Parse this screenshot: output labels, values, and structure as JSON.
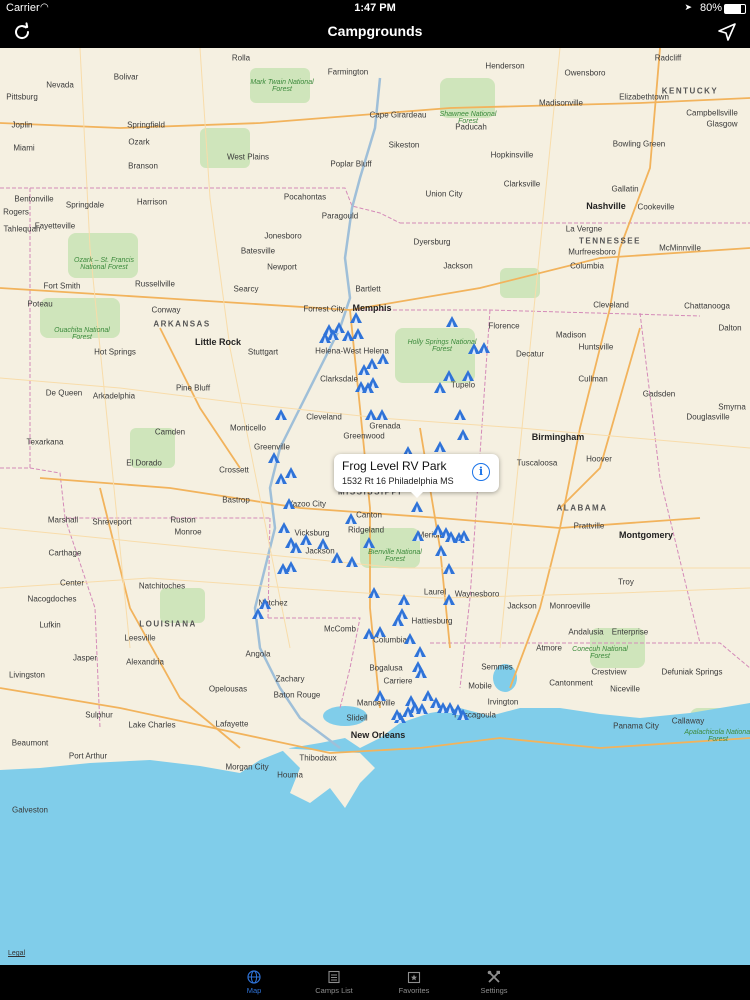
{
  "status_bar": {
    "carrier": "Carrier",
    "time": "1:47 PM",
    "battery": "80%"
  },
  "nav": {
    "title": "Campgrounds"
  },
  "callout": {
    "name": "Frog Level RV Park",
    "address": "1532 Rt 16 Philadelphia MS"
  },
  "map": {
    "legal": "Legal",
    "states": [
      "KENTUCKY",
      "TENNESSEE",
      "ARKANSAS",
      "MISSISSIPPI",
      "ALABAMA",
      "LOUISIANA"
    ],
    "forests": [
      "Mark Twain National Forest",
      "Shawnee National Forest",
      "Ozark – St. Francis National Forest",
      "Ouachita National Forest",
      "Holly Springs National Forest",
      "Bienville National Forest",
      "Conecuh National Forest",
      "Apalachicola National Forest"
    ],
    "cities": [
      "Nevada",
      "Rolla",
      "Farmington",
      "Henderson",
      "Radcliff",
      "Bolivar",
      "Owensboro",
      "Pittsburg",
      "Joplin",
      "Springfield",
      "Cape Girardeau",
      "Madisonville",
      "Elizabethtown",
      "Ozark",
      "Paducah",
      "Glasgow",
      "Campbellsville",
      "Miami",
      "West Plains",
      "Sikeston",
      "Hopkinsville",
      "Bowling Green",
      "Branson",
      "Poplar Bluff",
      "Clarksville",
      "Gallatin",
      "Bentonville",
      "Springdale",
      "Harrison",
      "Pocahontas",
      "Union City",
      "Nashville",
      "Cookeville",
      "Rogers",
      "Fayetteville",
      "Paragould",
      "La Vergne",
      "Tahlequah",
      "Jonesboro",
      "Batesville",
      "Dyersburg",
      "Murfreesboro",
      "McMinnville",
      "Newport",
      "Jackson",
      "Columbia",
      "Russellville",
      "Searcy",
      "Bartlett",
      "Fort Smith",
      "Memphis",
      "Forrest City",
      "Poteau",
      "Conway",
      "Cleveland",
      "Chattanooga",
      "Florence",
      "Dalton",
      "Little Rock",
      "Madison",
      "Huntsville",
      "Hot Springs",
      "Stuttgart",
      "Helena-West Helena",
      "Decatur",
      "Clarksdale",
      "Cullman",
      "Pine Bluff",
      "Tupelo",
      "Gadsden",
      "De Queen",
      "Arkadelphia",
      "Smyrna",
      "Cleveland",
      "Douglasville",
      "Texarkana",
      "Camden",
      "Monticello",
      "Greenwood",
      "Grenada",
      "Birmingham",
      "Greenville",
      "Tuscaloosa",
      "El Dorado",
      "Crossett",
      "Hoover",
      "Bastrop",
      "Yazoo City",
      "Marshall",
      "Shreveport",
      "Ruston",
      "Monroe",
      "Canton",
      "Ridgeland",
      "Meridian",
      "Prattville",
      "Carthage",
      "Jackson",
      "Montgomery",
      "Vicksburg",
      "Center",
      "Natchitoches",
      "Laurel",
      "Waynesboro",
      "Troy",
      "Nacogdoches",
      "Natchez",
      "Jackson",
      "Monroeville",
      "Enterprise",
      "Lufkin",
      "Leesville",
      "McComb",
      "Hattiesburg",
      "Andalusia",
      "Columbia",
      "Atmore",
      "Jasper",
      "Alexandria",
      "Angola",
      "Bogalusa",
      "Crestview",
      "Semmes",
      "Defuniak Springs",
      "Livingston",
      "Zachary",
      "Opelousas",
      "Carriere",
      "Cantonment",
      "Niceville",
      "Mobile",
      "Baton Rouge",
      "Mandeville",
      "Sulphur",
      "Lake Charles",
      "Lafayette",
      "Slidell",
      "Pascagoula",
      "Irvington",
      "Panama City",
      "Callaway",
      "Beaumont",
      "Port Arthur",
      "Morgan City",
      "New Orleans",
      "Thibodaux",
      "Houma",
      "Galveston"
    ]
  },
  "tabs": [
    {
      "label": "Map",
      "icon": "globe-icon"
    },
    {
      "label": "Camps List",
      "icon": "list-icon"
    },
    {
      "label": "Favorites",
      "icon": "star-icon"
    },
    {
      "label": "Settings",
      "icon": "tools-icon"
    }
  ],
  "colors": {
    "accent": "#2f73d8",
    "pin": "#2f73d8",
    "water": "#7ccbea",
    "land": "#f5f0e1",
    "forest": "#c8e2b3"
  }
}
